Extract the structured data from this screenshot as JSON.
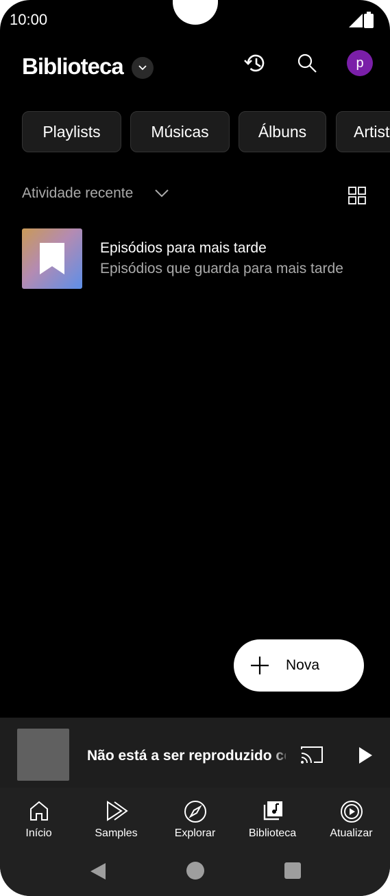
{
  "status": {
    "time": "10:00"
  },
  "header": {
    "title": "Biblioteca",
    "avatar_letter": "p",
    "avatar_color": "#7a1fa8"
  },
  "chips": [
    "Playlists",
    "Músicas",
    "Álbuns",
    "Artistas"
  ],
  "recent": {
    "label": "Atividade recente"
  },
  "items": [
    {
      "title": "Episódios para mais tarde",
      "subtitle": "Episódios que guarda para mais tarde",
      "icon": "bookmark-icon"
    }
  ],
  "fab": {
    "label": "Nova"
  },
  "miniplayer": {
    "text": "Não está a ser reproduzido conteúdo"
  },
  "bottom_nav": [
    "Início",
    "Samples",
    "Explorar",
    "Biblioteca",
    "Atualizar"
  ]
}
